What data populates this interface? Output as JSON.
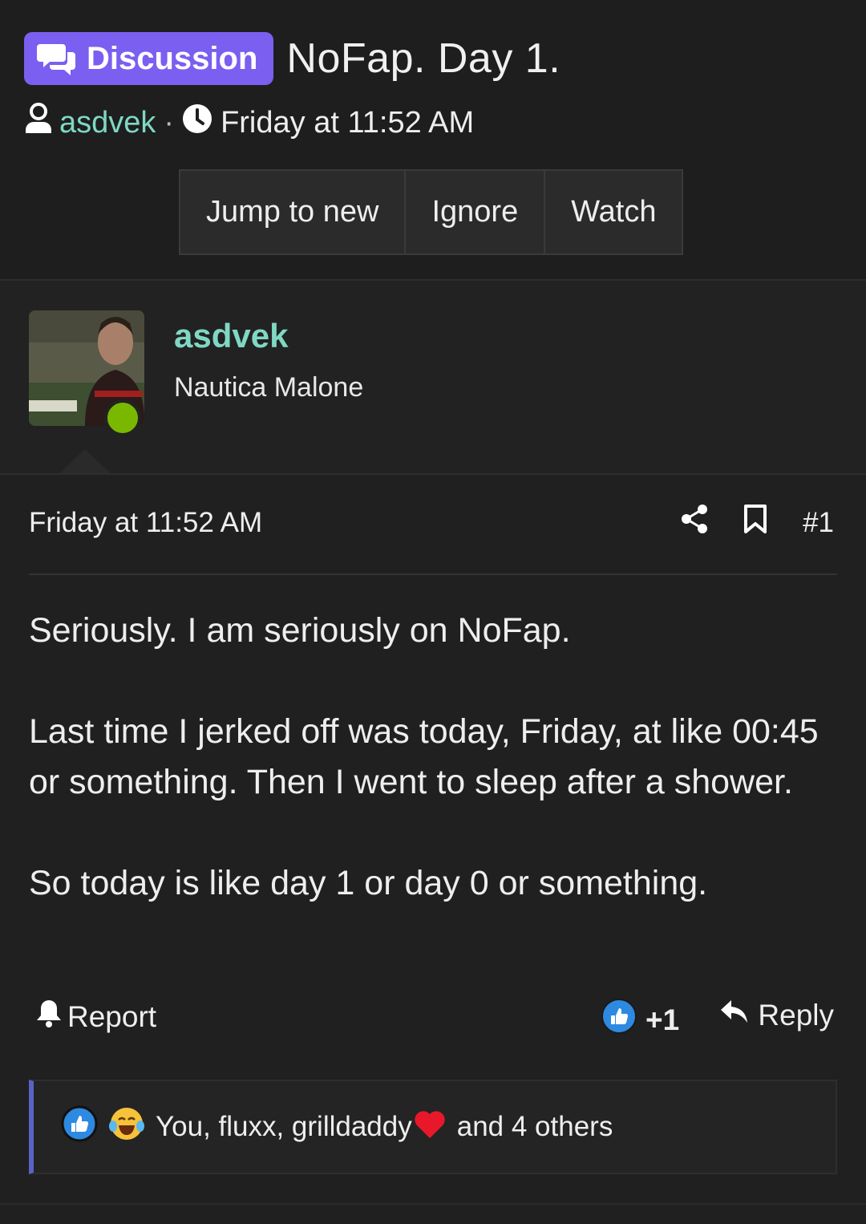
{
  "thread": {
    "prefix": "Discussion",
    "title": "NoFap. Day 1.",
    "author": "asdvek",
    "separator": "·",
    "date": "Friday at 11:52 AM"
  },
  "thread_actions": {
    "jump_label": "Jump to new",
    "ignore_label": "Ignore",
    "watch_label": "Watch"
  },
  "user": {
    "name": "asdvek",
    "title": "Nautica Malone",
    "status": "online"
  },
  "post": {
    "date": "Friday at 11:52 AM",
    "number": "#1",
    "paragraphs": [
      "Seriously. I am seriously on NoFap.",
      "Last time I jerked off was today, Friday, at like 00:45 or something. Then I went to sleep after a shower.",
      "So today is like day 1 or day 0 or something."
    ],
    "report_label": "Report",
    "reaction_label": "+1",
    "reply_label": "Reply"
  },
  "reactions": {
    "text": "You, fluxx, grilldaddy",
    "suffix": "and 4 others"
  },
  "colors": {
    "accent": "#7b5ff0",
    "username": "#7fd8c4",
    "online": "#7ab800",
    "reaction_border": "#5a63c4",
    "background": "#202020"
  },
  "icons": [
    "chat-bubbles-icon",
    "user-icon",
    "clock-icon",
    "share-icon",
    "bookmark-icon",
    "bell-icon",
    "thumbs-up-icon",
    "reply-arrow-icon",
    "laughing-emoji-icon",
    "heart-icon"
  ]
}
